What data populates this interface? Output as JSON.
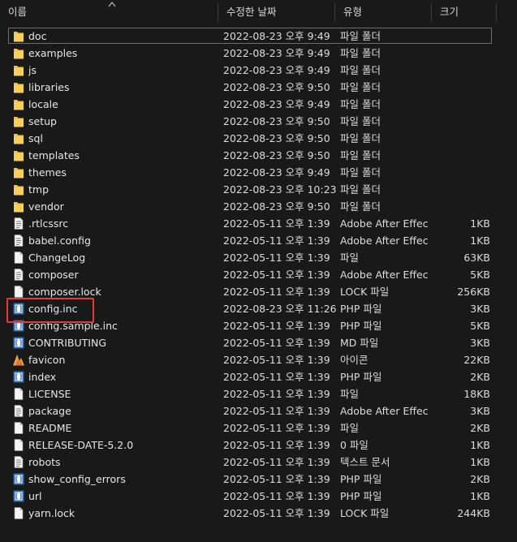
{
  "columns": {
    "name": "이름",
    "date": "수정한 날짜",
    "type": "유형",
    "size": "크기"
  },
  "colors": {
    "folder": "#f2c14a",
    "selected_border": "#6d6d6d",
    "highlight": "#e23b3b"
  },
  "files": [
    {
      "name": "doc",
      "date": "2022-08-23 오후 9:49",
      "type": "파일 폴더",
      "size": "",
      "icon": "folder-icon"
    },
    {
      "name": "examples",
      "date": "2022-08-23 오후 9:49",
      "type": "파일 폴더",
      "size": "",
      "icon": "folder-icon"
    },
    {
      "name": "js",
      "date": "2022-08-23 오후 9:49",
      "type": "파일 폴더",
      "size": "",
      "icon": "folder-icon"
    },
    {
      "name": "libraries",
      "date": "2022-08-23 오후 9:50",
      "type": "파일 폴더",
      "size": "",
      "icon": "folder-icon"
    },
    {
      "name": "locale",
      "date": "2022-08-23 오후 9:49",
      "type": "파일 폴더",
      "size": "",
      "icon": "folder-icon"
    },
    {
      "name": "setup",
      "date": "2022-08-23 오후 9:50",
      "type": "파일 폴더",
      "size": "",
      "icon": "folder-icon"
    },
    {
      "name": "sql",
      "date": "2022-08-23 오후 9:50",
      "type": "파일 폴더",
      "size": "",
      "icon": "folder-icon"
    },
    {
      "name": "templates",
      "date": "2022-08-23 오후 9:50",
      "type": "파일 폴더",
      "size": "",
      "icon": "folder-icon"
    },
    {
      "name": "themes",
      "date": "2022-08-23 오후 9:49",
      "type": "파일 폴더",
      "size": "",
      "icon": "folder-icon"
    },
    {
      "name": "tmp",
      "date": "2022-08-23 오후 10:23",
      "type": "파일 폴더",
      "size": "",
      "icon": "folder-icon"
    },
    {
      "name": "vendor",
      "date": "2022-08-23 오후 9:50",
      "type": "파일 폴더",
      "size": "",
      "icon": "folder-icon"
    },
    {
      "name": ".rtlcssrc",
      "date": "2022-05-11 오후 1:39",
      "type": "Adobe After Effec...",
      "size": "1KB",
      "icon": "text-document-icon"
    },
    {
      "name": "babel.config",
      "date": "2022-05-11 오후 1:39",
      "type": "Adobe After Effec...",
      "size": "1KB",
      "icon": "text-document-icon"
    },
    {
      "name": "ChangeLog",
      "date": "2022-05-11 오후 1:39",
      "type": "파일",
      "size": "63KB",
      "icon": "blank-document-icon"
    },
    {
      "name": "composer",
      "date": "2022-05-11 오후 1:39",
      "type": "Adobe After Effec...",
      "size": "5KB",
      "icon": "text-document-icon"
    },
    {
      "name": "composer.lock",
      "date": "2022-05-11 오후 1:39",
      "type": "LOCK 파일",
      "size": "256KB",
      "icon": "blank-document-icon"
    },
    {
      "name": "config.inc",
      "date": "2022-08-23 오후 11:26",
      "type": "PHP 파일",
      "size": "3KB",
      "icon": "php-file-icon"
    },
    {
      "name": "config.sample.inc",
      "date": "2022-05-11 오후 1:39",
      "type": "PHP 파일",
      "size": "5KB",
      "icon": "php-file-icon"
    },
    {
      "name": "CONTRIBUTING",
      "date": "2022-05-11 오후 1:39",
      "type": "MD 파일",
      "size": "3KB",
      "icon": "php-file-icon"
    },
    {
      "name": "favicon",
      "date": "2022-05-11 오후 1:39",
      "type": "아이콘",
      "size": "22KB",
      "icon": "favicon-icon"
    },
    {
      "name": "index",
      "date": "2022-05-11 오후 1:39",
      "type": "PHP 파일",
      "size": "2KB",
      "icon": "php-file-icon"
    },
    {
      "name": "LICENSE",
      "date": "2022-05-11 오후 1:39",
      "type": "파일",
      "size": "18KB",
      "icon": "blank-document-icon"
    },
    {
      "name": "package",
      "date": "2022-05-11 오후 1:39",
      "type": "Adobe After Effec...",
      "size": "3KB",
      "icon": "text-document-icon"
    },
    {
      "name": "README",
      "date": "2022-05-11 오후 1:39",
      "type": "파일",
      "size": "2KB",
      "icon": "blank-document-icon"
    },
    {
      "name": "RELEASE-DATE-5.2.0",
      "date": "2022-05-11 오후 1:39",
      "type": "0 파일",
      "size": "1KB",
      "icon": "blank-document-icon"
    },
    {
      "name": "robots",
      "date": "2022-05-11 오후 1:39",
      "type": "텍스트 문서",
      "size": "1KB",
      "icon": "text-document-icon"
    },
    {
      "name": "show_config_errors",
      "date": "2022-05-11 오후 1:39",
      "type": "PHP 파일",
      "size": "2KB",
      "icon": "php-file-icon"
    },
    {
      "name": "url",
      "date": "2022-05-11 오후 1:39",
      "type": "PHP 파일",
      "size": "1KB",
      "icon": "php-file-icon"
    },
    {
      "name": "yarn.lock",
      "date": "2022-05-11 오후 1:39",
      "type": "LOCK 파일",
      "size": "244KB",
      "icon": "blank-document-icon"
    }
  ]
}
